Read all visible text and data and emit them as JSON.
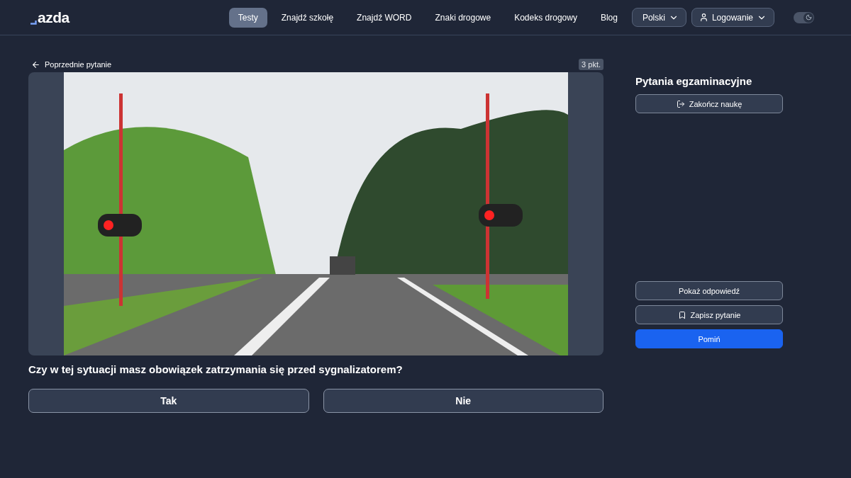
{
  "header": {
    "logo": "azda",
    "nav": [
      {
        "label": "Testy",
        "selected": true
      },
      {
        "label": "Znajdź szkołę",
        "selected": false
      },
      {
        "label": "Znajdź WORD",
        "selected": false
      },
      {
        "label": "Znaki drogowe",
        "selected": false
      },
      {
        "label": "Kodeks drogowy",
        "selected": false
      },
      {
        "label": "Blog",
        "selected": false
      }
    ],
    "language": "Polski",
    "login": "Logowanie",
    "dark_mode": true
  },
  "question": {
    "back": "Poprzednie pytanie",
    "points": "3 pkt.",
    "text": "Czy w tej sytuacji masz obowiązek zatrzymania się przed sygnalizatorem?",
    "answers": [
      "Tak",
      "Nie"
    ]
  },
  "sidebar": {
    "title": "Pytania egzaminacyjne",
    "finish": "Zakończ naukę",
    "actions": [
      {
        "kind": "outline",
        "label": "Pokaż odpowiedź"
      },
      {
        "kind": "bookmark",
        "label": "Zapisz pytanie"
      },
      {
        "kind": "primary",
        "label": "Pomiń"
      }
    ]
  }
}
